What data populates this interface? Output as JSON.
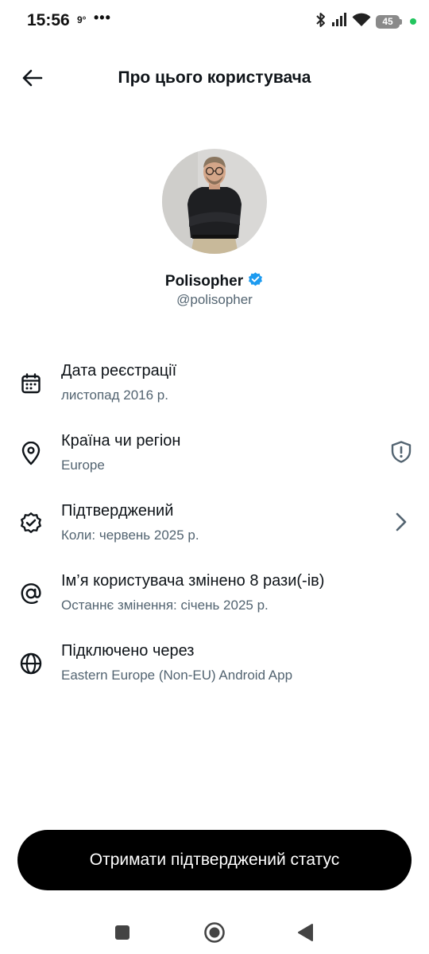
{
  "status_bar": {
    "time": "15:56",
    "temperature": "9°",
    "more": "•••",
    "battery": "45",
    "icons": [
      "bluetooth-icon",
      "signal-icon",
      "wifi-icon",
      "battery-icon",
      "green-dot-indicator"
    ]
  },
  "header": {
    "title": "Про цього користувача",
    "back_icon": "arrow-left-icon"
  },
  "profile": {
    "name": "Polisopher",
    "handle": "@polisopher",
    "verified_badge": "verified-badge-icon",
    "badge_color": "#1d9bf0"
  },
  "info": [
    {
      "icon": "calendar-icon",
      "title": "Дата реєстрації",
      "subtitle": "листопад 2016 р."
    },
    {
      "icon": "location-pin-icon",
      "title": "Країна чи регіон",
      "subtitle": "Europe",
      "trailing_icon": "shield-alert-icon"
    },
    {
      "icon": "verified-check-icon",
      "title": "Підтверджений",
      "subtitle": "Коли: червень 2025 р.",
      "trailing_icon": "chevron-right-icon"
    },
    {
      "icon": "at-sign-icon",
      "title": "Ім’я користувача змінено 8 рази(-ів)",
      "subtitle": "Останнє змінення: січень 2025 р."
    },
    {
      "icon": "globe-icon",
      "title": "Підключено через",
      "subtitle": "Eastern Europe (Non-EU) Android App"
    }
  ],
  "cta": {
    "label": "Отримати підтверджений статус"
  },
  "nav": {
    "icons": [
      "recents-square-icon",
      "home-circle-icon",
      "back-triangle-icon"
    ]
  },
  "colors": {
    "primary_text": "#0f1419",
    "secondary_text": "#536471",
    "cta_background": "#000000",
    "verified": "#1d9bf0"
  }
}
